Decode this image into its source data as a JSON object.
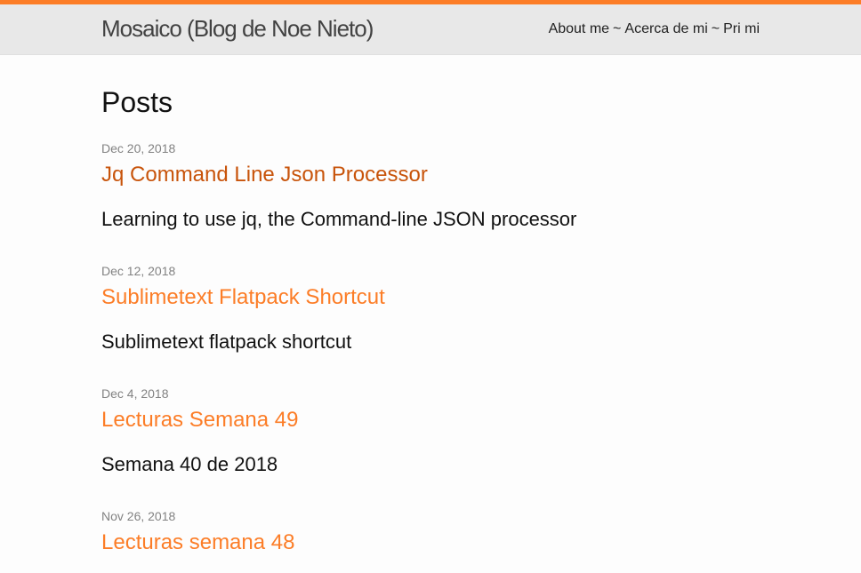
{
  "site": {
    "title": "Mosaico (Blog de Noe Nieto)",
    "accent_color": "#fc7d27"
  },
  "nav": {
    "items": [
      {
        "label": "About me"
      },
      {
        "label": "Acerca de mi"
      },
      {
        "label": "Pri mi"
      }
    ],
    "separator": "~"
  },
  "main": {
    "heading": "Posts",
    "posts": [
      {
        "date": "Dec 20, 2018",
        "title": "Jq Command Line Json Processor",
        "excerpt": "Learning to use jq, the Command-line JSON processor"
      },
      {
        "date": "Dec 12, 2018",
        "title": "Sublimetext Flatpack Shortcut",
        "excerpt": "Sublimetext flatpack shortcut"
      },
      {
        "date": "Dec 4, 2018",
        "title": "Lecturas Semana 49",
        "excerpt": "Semana 40 de 2018"
      },
      {
        "date": "Nov 26, 2018",
        "title": "Lecturas semana 48",
        "excerpt": ""
      }
    ]
  }
}
